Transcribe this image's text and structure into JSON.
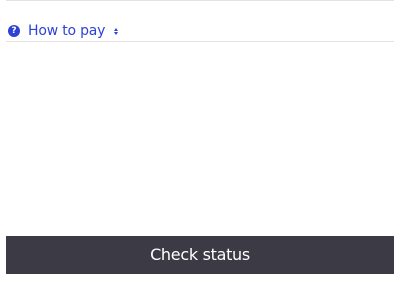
{
  "how_to_pay": {
    "icon": "question-circle-icon",
    "label": "How to pay",
    "toggle_icon": "sort-arrows-icon"
  },
  "actions": {
    "check_status_label": "Check status"
  },
  "colors": {
    "link": "#2f42d6",
    "button_bg": "#3b3a45",
    "button_text": "#ffffff",
    "divider": "#e3e3e6"
  }
}
